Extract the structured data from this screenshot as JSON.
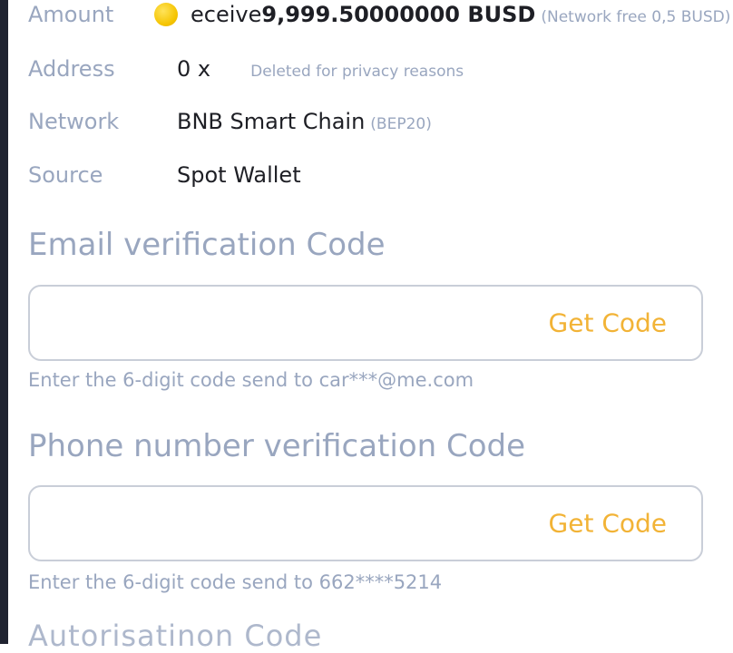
{
  "details": {
    "amount": {
      "label": "Amount",
      "value_prefix": "eceive ",
      "value_bold": "9,999.50000000 BUSD",
      "note": "(Network free 0,5 BUSD)"
    },
    "address": {
      "label": "Address",
      "value": "0 x",
      "note": "Deleted for privacy reasons"
    },
    "network": {
      "label": "Network",
      "value": "BNB Smart Chain",
      "note": "(BEP20)"
    },
    "source": {
      "label": "Source",
      "value": "Spot Wallet"
    }
  },
  "email_verification": {
    "title": "Email verification Code",
    "value": "",
    "get_code_label": "Get Code",
    "hint": "Enter the 6-digit code send to car***@me.com"
  },
  "phone_verification": {
    "title": "Phone number verification Code",
    "value": "",
    "get_code_label": "Get Code",
    "hint": "Enter the 6-digit code send to 662****5214"
  },
  "next_section": {
    "title": "Autorisatinon Code"
  },
  "colors": {
    "label": "#99a6bf",
    "value": "#1e1f25",
    "accent": "#f2b336",
    "border": "#c9ced8",
    "coin": "#f5c400"
  },
  "icons": {
    "amount_coin": "coin-icon"
  }
}
